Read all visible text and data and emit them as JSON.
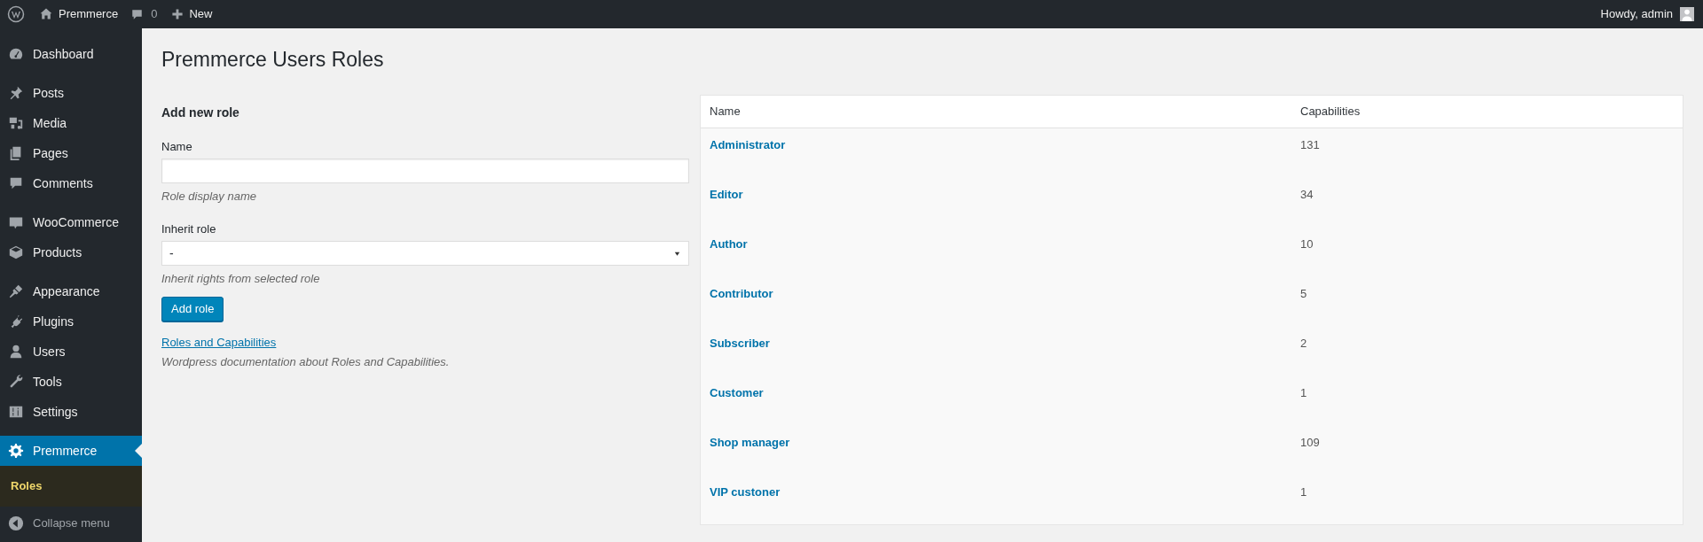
{
  "admin_bar": {
    "site_name": "Premmerce",
    "comments_count": "0",
    "new_label": "New",
    "greeting": "Howdy, admin"
  },
  "sidebar": {
    "groups": [
      [
        {
          "label": "Dashboard",
          "selected": false
        }
      ],
      [
        {
          "label": "Posts",
          "selected": false
        },
        {
          "label": "Media",
          "selected": false
        },
        {
          "label": "Pages",
          "selected": false
        },
        {
          "label": "Comments",
          "selected": false
        }
      ],
      [
        {
          "label": "WooCommerce",
          "selected": false
        },
        {
          "label": "Products",
          "selected": false
        }
      ],
      [
        {
          "label": "Appearance",
          "selected": false
        },
        {
          "label": "Plugins",
          "selected": false
        },
        {
          "label": "Users",
          "selected": false
        },
        {
          "label": "Tools",
          "selected": false
        },
        {
          "label": "Settings",
          "selected": false
        }
      ],
      [
        {
          "label": "Premmerce",
          "selected": true,
          "children": [
            {
              "label": "Roles",
              "selected": true
            }
          ]
        }
      ]
    ],
    "collapse_label": "Collapse menu"
  },
  "page_title": "Premmerce Users Roles",
  "form": {
    "heading": "Add new role",
    "name_label": "Name",
    "name_hint": "Role display name",
    "inherit_label": "Inherit role",
    "inherit_value": "-",
    "inherit_hint": "Inherit rights from selected role",
    "submit": "Add role",
    "doc_link": "Roles and Capabilities",
    "doc_note": "Wordpress documentation about Roles and Capabilities."
  },
  "table": {
    "columns": [
      "Name",
      "Capabilities"
    ],
    "rows": [
      {
        "name": "Administrator",
        "capabilities": "131"
      },
      {
        "name": "Editor",
        "capabilities": "34"
      },
      {
        "name": "Author",
        "capabilities": "10"
      },
      {
        "name": "Contributor",
        "capabilities": "5"
      },
      {
        "name": "Subscriber",
        "capabilities": "2"
      },
      {
        "name": "Customer",
        "capabilities": "1"
      },
      {
        "name": "Shop manager",
        "capabilities": "109"
      },
      {
        "name": "VIP custoner",
        "capabilities": "1"
      }
    ]
  }
}
